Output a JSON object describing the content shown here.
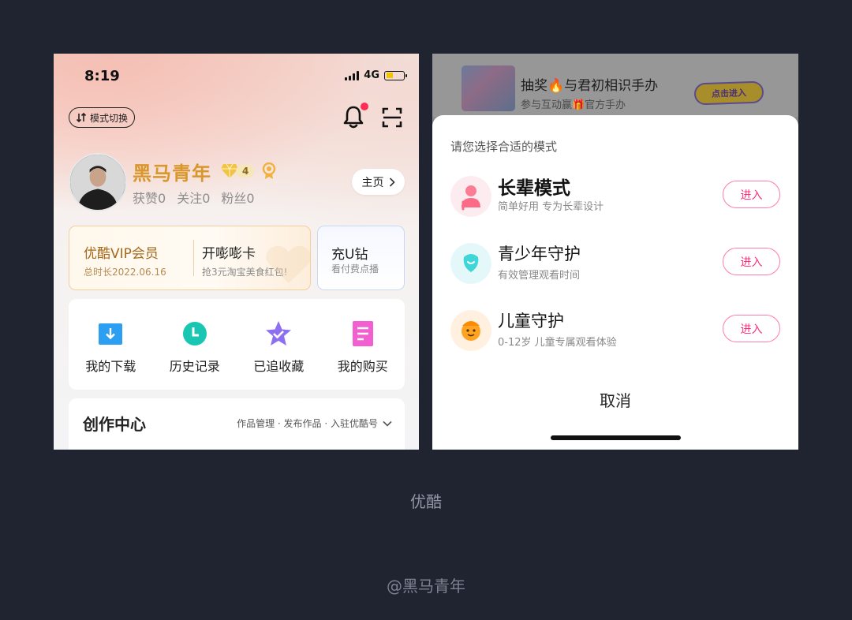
{
  "left": {
    "status": {
      "time": "8:19",
      "network": "4G"
    },
    "mode_switch_label": "模式切换",
    "profile": {
      "name": "黑马青年",
      "level": "4",
      "stats": {
        "likes": "获赞0",
        "following": "关注0",
        "fans": "粉丝0"
      },
      "home_label": "主页"
    },
    "vip": {
      "title": "优酷VIP会员",
      "subtitle": "总时长2022.06.16",
      "promo_title": "开嘭嘭卡",
      "promo_subtitle": "抢3元淘宝美食红包!"
    },
    "u_diamond": {
      "title": "充U钻",
      "subtitle": "看付费点播"
    },
    "quick": [
      {
        "label": "我的下载"
      },
      {
        "label": "历史记录"
      },
      {
        "label": "已追收藏"
      },
      {
        "label": "我的购买"
      }
    ],
    "create": {
      "title": "创作中心",
      "links": "作品管理 · 发布作品 · 入驻优酷号"
    }
  },
  "right": {
    "banner": {
      "title": "抽奖🔥与君初相识手办",
      "subtitle": "参与互动赢🎁官方手办",
      "button": "点击进入"
    },
    "sheet": {
      "prompt": "请您选择合适的模式",
      "modes": [
        {
          "title": "长辈模式",
          "desc": "简单好用 专为长辈设计",
          "button": "进入"
        },
        {
          "title": "青少年守护",
          "desc": "有效管理观看时间",
          "button": "进入"
        },
        {
          "title": "儿童守护",
          "desc": "0-12岁 儿童专属观看体验",
          "button": "进入"
        }
      ],
      "cancel": "取消"
    }
  },
  "caption": "优酷",
  "watermark": "@黑马青年",
  "colors": {
    "accent_gold": "#d9962b",
    "accent_pink": "#ff2e7c",
    "background": "#202430"
  }
}
